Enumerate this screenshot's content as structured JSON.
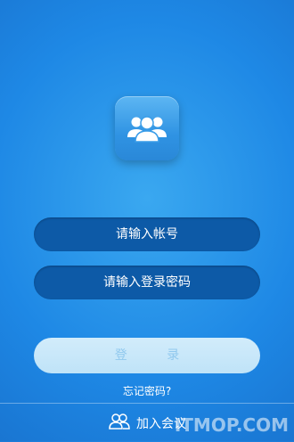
{
  "login": {
    "account_placeholder": "请输入帐号",
    "password_placeholder": "请输入登录密码",
    "login_label": "登 录",
    "forgot_label": "忘记密码?"
  },
  "footer": {
    "join_label": "加入会议",
    "watermark": "ITMOP.COM"
  },
  "icons": {
    "logo": "group-users-icon",
    "join": "users-outline-icon"
  }
}
